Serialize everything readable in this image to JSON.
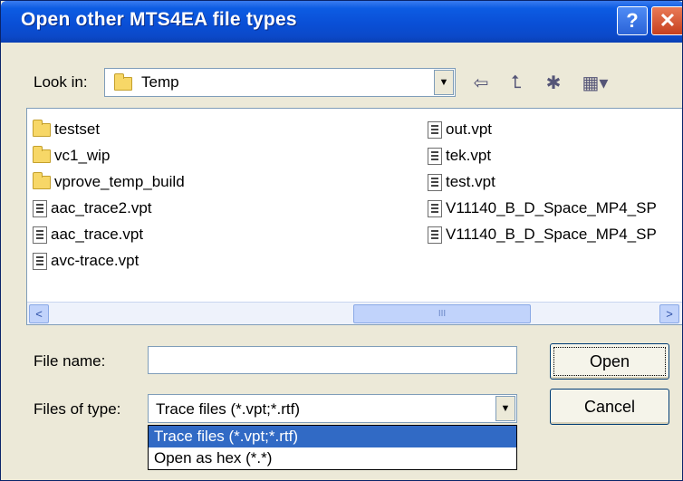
{
  "dialog": {
    "title": "Open other MTS4EA file types"
  },
  "titlebar_buttons": {
    "help": "?",
    "close": "✕"
  },
  "look_in": {
    "label": "Look in:",
    "value": "Temp"
  },
  "toolbar": {
    "back": "⇦",
    "up": "⮤",
    "new_folder": "✱",
    "view_menu": "▦▾"
  },
  "files": {
    "column1": [
      {
        "name": "testset",
        "type": "folder"
      },
      {
        "name": "vc1_wip",
        "type": "folder"
      },
      {
        "name": "vprove_temp_build",
        "type": "folder"
      },
      {
        "name": "aac_trace2.vpt",
        "type": "file"
      },
      {
        "name": "aac_trace.vpt",
        "type": "file"
      },
      {
        "name": "avc-trace.vpt",
        "type": "file"
      }
    ],
    "column2": [
      {
        "name": "out.vpt",
        "type": "file"
      },
      {
        "name": "tek.vpt",
        "type": "file"
      },
      {
        "name": "test.vpt",
        "type": "file"
      },
      {
        "name": "V11140_B_D_Space_MP4_SP",
        "type": "file"
      },
      {
        "name": "V11140_B_D_Space_MP4_SP",
        "type": "file"
      }
    ]
  },
  "scrollbar": {
    "left_arrow": "<",
    "right_arrow": ">",
    "thumb_grip": "III"
  },
  "file_name": {
    "label": "File name:",
    "value": ""
  },
  "files_of_type": {
    "label": "Files of type:",
    "value": "Trace files (*.vpt;*.rtf)",
    "options": [
      "Trace files (*.vpt;*.rtf)",
      "Open as hex (*.*)"
    ]
  },
  "buttons": {
    "open": "Open",
    "cancel": "Cancel"
  }
}
